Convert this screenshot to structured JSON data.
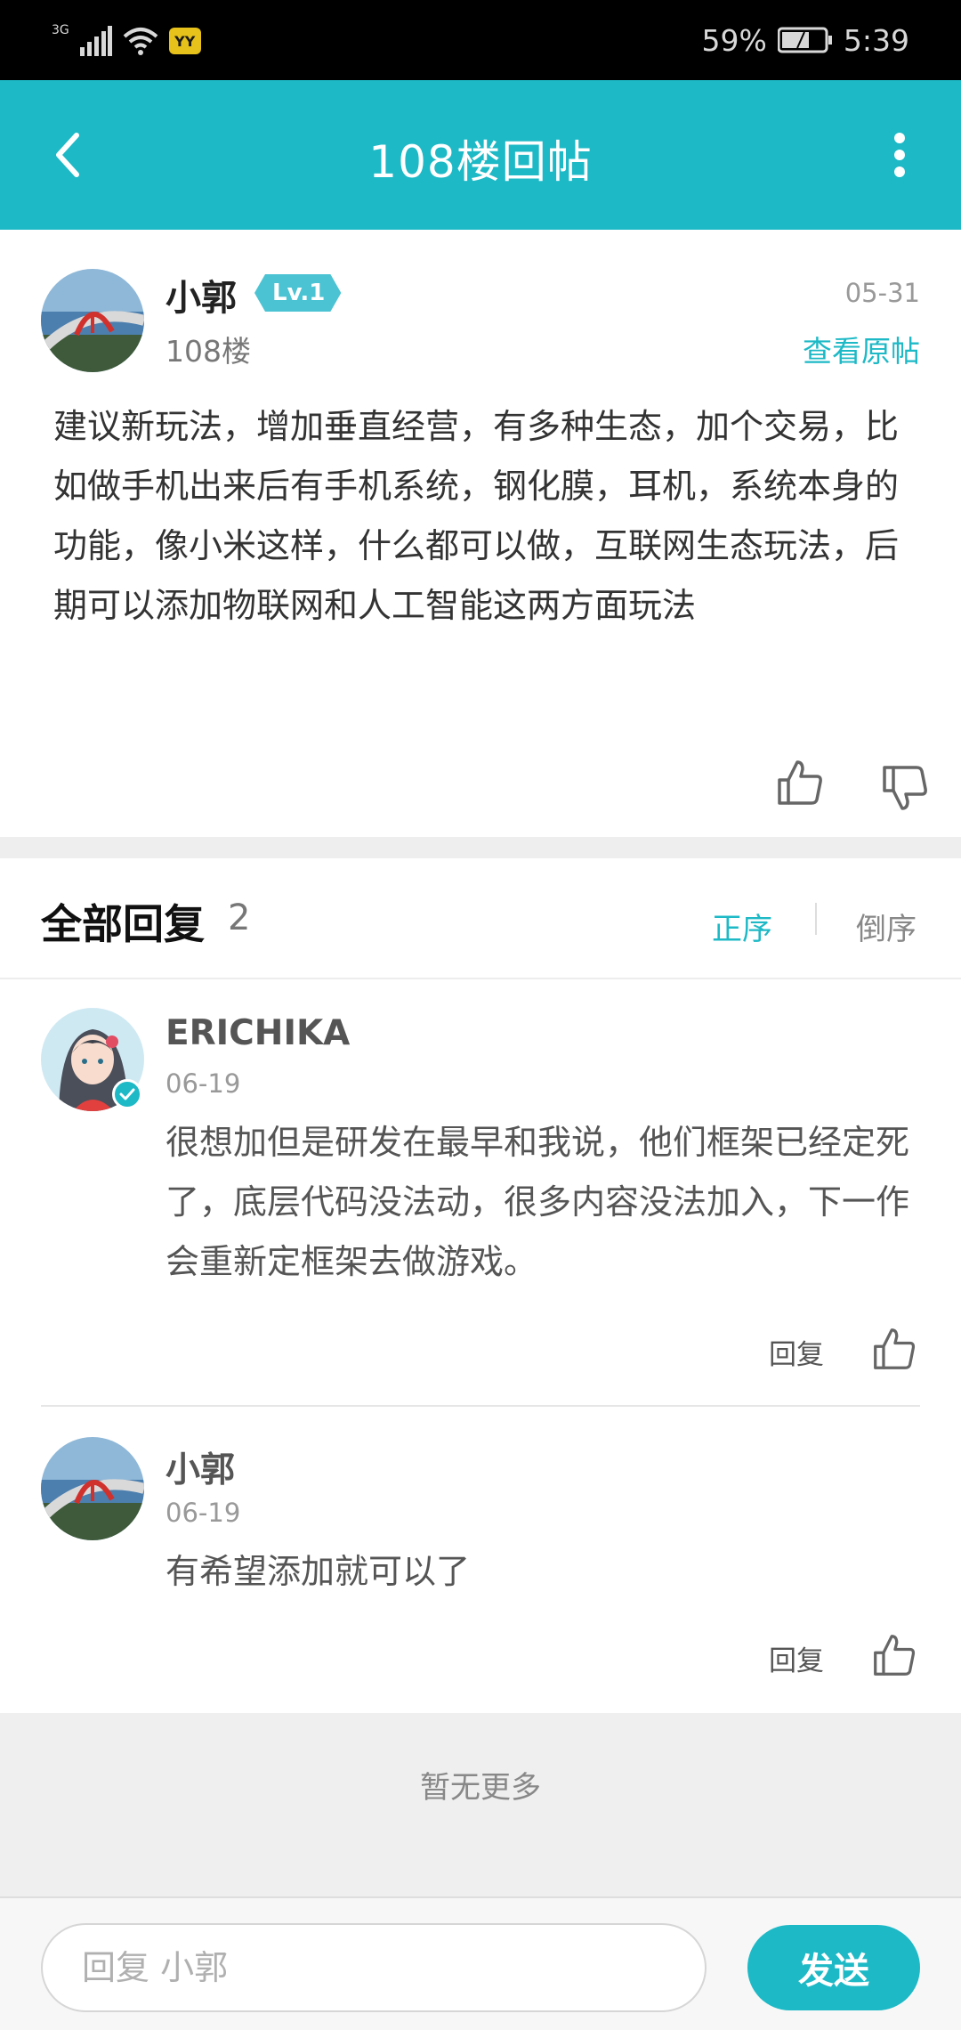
{
  "status_bar": {
    "network": "3G",
    "app_icon_text": "YY",
    "battery": "59%",
    "time": "5:39"
  },
  "app_bar": {
    "title": "108楼回帖",
    "back_icon": "chevron-left-icon",
    "more_icon": "more-vertical-icon"
  },
  "post": {
    "author": "小郭",
    "level": "Lv.1",
    "floor": "108楼",
    "date": "05-31",
    "view_original": "查看原帖",
    "content": "建议新玩法，增加垂直经营，有多种生态，加个交易，比如做手机出来后有手机系统，钢化膜，耳机，系统本身的功能，像小米这样，什么都可以做，互联网生态玩法，后期可以添加物联网和人工智能这两方面玩法"
  },
  "replies": {
    "title": "全部回复",
    "count": "2",
    "sort_asc": "正序",
    "sort_desc": "倒序",
    "items": [
      {
        "author": "ERICHIKA",
        "date": "06-19",
        "content": "很想加但是研发在最早和我说，他们框架已经定死了，底层代码没法动，很多内容没法加入，下一作会重新定框架去做游戏。",
        "reply_label": "回复",
        "verified": true
      },
      {
        "author": "小郭",
        "date": "06-19",
        "content": "有希望添加就可以了",
        "reply_label": "回复",
        "verified": false
      }
    ],
    "no_more": "暂无更多"
  },
  "composer": {
    "placeholder": "回复 小郭",
    "send_label": "发送"
  },
  "colors": {
    "accent": "#1db9c6",
    "level_badge": "#4cc3d3",
    "status_bar": "#000000",
    "divider": "#eeeeee"
  }
}
